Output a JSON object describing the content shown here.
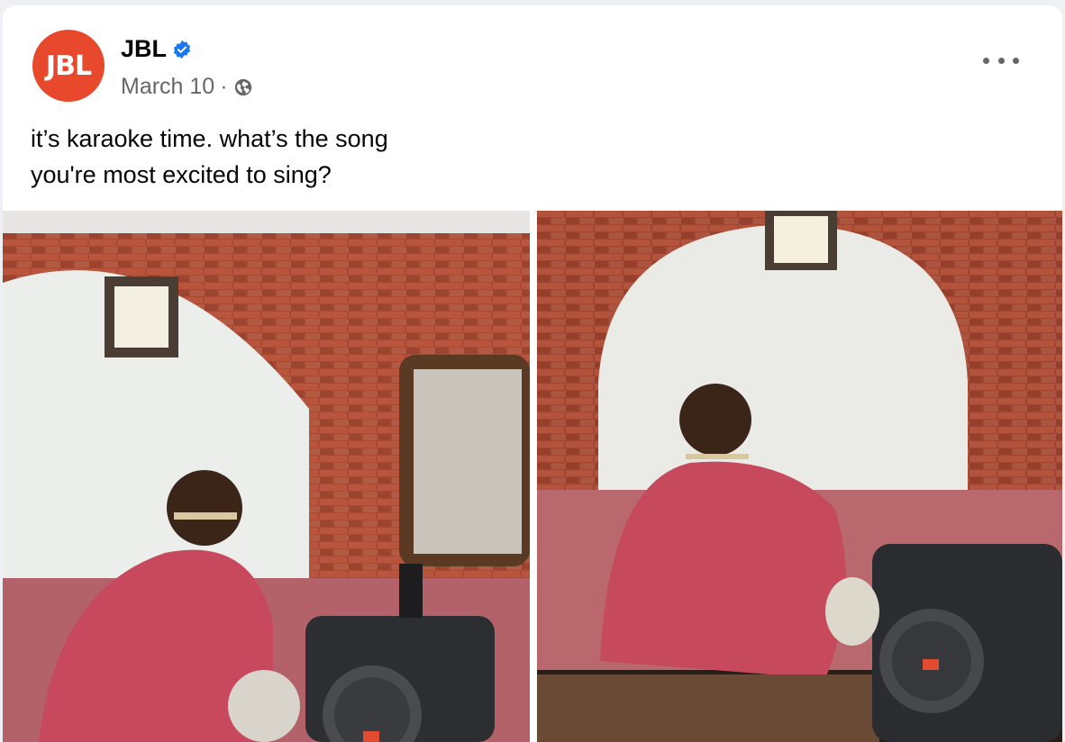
{
  "post": {
    "author": "JBL",
    "avatar_text": "JBL",
    "verified_icon": "verified-badge-icon",
    "date": "March 10",
    "separator": "·",
    "privacy_icon": "globe-icon",
    "caption_line1": "it’s karaoke time. what’s the song",
    "caption_line2": "you're most excited to sing?",
    "more_icon": "more-options-icon"
  },
  "photos": [
    {
      "name": "photo-left"
    },
    {
      "name": "photo-right"
    }
  ],
  "colors": {
    "brand": "#e8492c",
    "verified": "#1877f2",
    "meta_text": "#65676b"
  }
}
